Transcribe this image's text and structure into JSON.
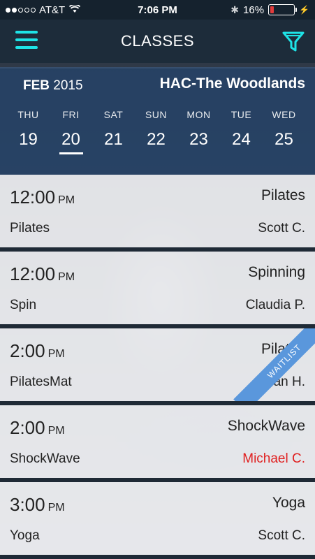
{
  "status_bar": {
    "carrier": "AT&T",
    "time": "7:06 PM",
    "battery": "16%",
    "battery_level": 0.16
  },
  "nav": {
    "title": "CLASSES",
    "accent_color": "#1ee3e6"
  },
  "date_header": {
    "month": "FEB",
    "year": "2015",
    "location": "HAC-The Woodlands",
    "days": [
      {
        "dow": "THU",
        "num": "19"
      },
      {
        "dow": "FRI",
        "num": "20",
        "selected": true
      },
      {
        "dow": "SAT",
        "num": "21"
      },
      {
        "dow": "SUN",
        "num": "22"
      },
      {
        "dow": "MON",
        "num": "23"
      },
      {
        "dow": "TUE",
        "num": "24"
      },
      {
        "dow": "WED",
        "num": "25"
      }
    ]
  },
  "classes": [
    {
      "time": "12:00",
      "ampm": "PM",
      "category": "Pilates",
      "name": "Pilates",
      "instructor": "Scott C."
    },
    {
      "time": "12:00",
      "ampm": "PM",
      "category": "Spinning",
      "name": "Spin",
      "instructor": "Claudia P."
    },
    {
      "time": "2:00",
      "ampm": "PM",
      "category": "Pilates",
      "name": "PilatesMat",
      "instructor": "Jan H.",
      "badge": "WAITLIST"
    },
    {
      "time": "2:00",
      "ampm": "PM",
      "category": "ShockWave",
      "name": "ShockWave",
      "instructor": "Michael C.",
      "instructor_color": "#e02020"
    },
    {
      "time": "3:00",
      "ampm": "PM",
      "category": "Yoga",
      "name": "Yoga",
      "instructor": "Scott C."
    }
  ]
}
